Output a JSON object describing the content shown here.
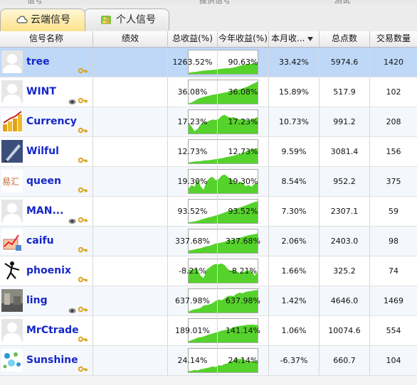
{
  "window": {
    "top_menu": [
      "信号",
      "提供信号",
      "测试"
    ]
  },
  "tabs": [
    {
      "label": "云端信号",
      "icon": "cloud-icon",
      "active": true
    },
    {
      "label": "个人信号",
      "icon": "people-icon",
      "active": false
    }
  ],
  "columns": [
    "信号名称",
    "绩效",
    "总收益(%)",
    "今年收益(%)",
    "本月收...",
    "总点数",
    "交易数量"
  ],
  "sort": {
    "column": "本月收...",
    "direction": "descending"
  },
  "colors": {
    "accent": "#1527c8",
    "chart_fill": "#55d22b",
    "selected_row": "#bfd8f7"
  },
  "signals": [
    {
      "name": "tree",
      "avatar": "default-avatar",
      "eye": false,
      "key": true,
      "total": "1263.52%",
      "year": "90.63%",
      "month": "33.42%",
      "points": "5974.6",
      "trades": "1420",
      "spark": [
        0.05,
        0.07,
        0.08,
        0.1,
        0.12,
        0.14,
        0.15,
        0.16,
        0.17,
        0.18,
        0.2,
        0.22,
        0.23,
        0.24,
        0.25,
        0.27,
        0.3,
        0.34,
        0.38,
        0.4,
        0.42,
        0.43,
        0.45,
        0.45
      ]
    },
    {
      "name": "WINT",
      "avatar": "default-avatar",
      "eye": true,
      "key": true,
      "total": "36.08%",
      "year": "36.08%",
      "month": "15.89%",
      "points": "517.9",
      "trades": "102",
      "spark": [
        0.02,
        0.05,
        0.12,
        0.2,
        0.25,
        0.28,
        0.32,
        0.35,
        0.38,
        0.4,
        0.42,
        0.45,
        0.48,
        0.5,
        0.55,
        0.58,
        0.6,
        0.62,
        0.65,
        0.7,
        0.75,
        0.82,
        0.88,
        0.95
      ]
    },
    {
      "name": "Currency",
      "avatar": "coins-avatar",
      "eye": false,
      "key": true,
      "total": "17.23%",
      "year": "17.23%",
      "month": "10.73%",
      "points": "991.2",
      "trades": "208",
      "spark": [
        0.45,
        0.3,
        0.1,
        0.2,
        0.38,
        0.5,
        0.48,
        0.55,
        0.6,
        0.58,
        0.62,
        0.75,
        0.8,
        0.72,
        0.68,
        0.7,
        0.65,
        0.6,
        0.62,
        0.6,
        0.55,
        0.6,
        0.65,
        0.7
      ]
    },
    {
      "name": "Wilful",
      "avatar": "pen-avatar",
      "eye": false,
      "key": true,
      "total": "12.73%",
      "year": "12.73%",
      "month": "9.59%",
      "points": "3081.4",
      "trades": "156",
      "spark": [
        0.04,
        0.06,
        0.08,
        0.09,
        0.1,
        0.12,
        0.13,
        0.14,
        0.16,
        0.18,
        0.2,
        0.22,
        0.25,
        0.28,
        0.3,
        0.33,
        0.36,
        0.4,
        0.45,
        0.5,
        0.55,
        0.6,
        0.62,
        0.65
      ]
    },
    {
      "name": "queen",
      "avatar": "logo-avatar",
      "eye": false,
      "key": true,
      "total": "19.30%",
      "year": "19.30%",
      "month": "8.54%",
      "points": "952.2",
      "trades": "375",
      "spark": [
        0.2,
        0.35,
        0.28,
        0.6,
        0.3,
        0.15,
        0.5,
        0.65,
        0.7,
        0.55,
        0.6,
        0.75,
        0.8,
        0.7,
        0.6,
        0.55,
        0.4,
        0.5,
        0.45,
        0.3,
        0.35,
        0.28,
        0.4,
        0.45
      ]
    },
    {
      "name": "MAN...",
      "avatar": "default-avatar",
      "eye": true,
      "key": true,
      "total": "93.52%",
      "year": "93.52%",
      "month": "7.30%",
      "points": "2307.1",
      "trades": "59",
      "spark": [
        0.03,
        0.05,
        0.07,
        0.1,
        0.14,
        0.18,
        0.22,
        0.25,
        0.28,
        0.32,
        0.36,
        0.4,
        0.45,
        0.5,
        0.55,
        0.58,
        0.62,
        0.66,
        0.7,
        0.75,
        0.8,
        0.85,
        0.9,
        0.92
      ]
    },
    {
      "name": "caifu",
      "avatar": "chart-avatar",
      "eye": false,
      "key": true,
      "total": "337.68%",
      "year": "337.68%",
      "month": "2.06%",
      "points": "2403.0",
      "trades": "98",
      "spark": [
        0.1,
        0.12,
        0.15,
        0.18,
        0.2,
        0.24,
        0.28,
        0.3,
        0.35,
        0.4,
        0.42,
        0.44,
        0.48,
        0.52,
        0.55,
        0.58,
        0.6,
        0.64,
        0.68,
        0.72,
        0.75,
        0.78,
        0.8,
        0.82
      ]
    },
    {
      "name": "phoenix",
      "avatar": "dancer-avatar",
      "eye": false,
      "key": true,
      "total": "-8.21%",
      "year": "-8.21%",
      "month": "1.66%",
      "points": "325.2",
      "trades": "74",
      "spark": [
        0.55,
        0.55,
        0.6,
        0.58,
        0.3,
        0.2,
        0.55,
        0.65,
        0.75,
        0.8,
        0.78,
        0.82,
        0.75,
        0.6,
        0.5,
        0.55,
        0.48,
        0.4,
        0.45,
        0.5,
        0.52,
        0.5,
        0.3,
        0.45
      ]
    },
    {
      "name": "ling",
      "avatar": "street-avatar",
      "eye": true,
      "key": true,
      "total": "637.98%",
      "year": "637.98%",
      "month": "1.42%",
      "points": "4646.0",
      "trades": "1469",
      "spark": [
        0.05,
        0.1,
        0.14,
        0.16,
        0.2,
        0.3,
        0.32,
        0.35,
        0.4,
        0.5,
        0.55,
        0.52,
        0.6,
        0.7,
        0.72,
        0.7,
        0.8,
        0.85,
        0.82,
        0.88,
        0.9,
        0.92,
        0.95,
        0.96
      ]
    },
    {
      "name": "MrCtrade",
      "avatar": "default-avatar",
      "eye": false,
      "key": true,
      "total": "189.01%",
      "year": "141.14%",
      "month": "1.06%",
      "points": "10074.6",
      "trades": "554",
      "spark": [
        0.05,
        0.1,
        0.14,
        0.2,
        0.22,
        0.25,
        0.3,
        0.35,
        0.38,
        0.42,
        0.45,
        0.5,
        0.52,
        0.55,
        0.6,
        0.65,
        0.68,
        0.7,
        0.72,
        0.74,
        0.75,
        0.76,
        0.75,
        0.74
      ]
    },
    {
      "name": "Sunshine",
      "avatar": "dots-avatar",
      "eye": false,
      "key": true,
      "total": "24.14%",
      "year": "24.14%",
      "month": "-6.37%",
      "points": "660.7",
      "trades": "104",
      "spark": [
        0.05,
        0.06,
        0.1,
        0.08,
        0.12,
        0.15,
        0.18,
        0.2,
        0.25,
        0.22,
        0.3,
        0.28,
        0.35,
        0.38,
        0.45,
        0.5,
        0.6,
        0.55,
        0.58,
        0.5,
        0.45,
        0.48,
        0.46,
        0.44
      ]
    }
  ]
}
